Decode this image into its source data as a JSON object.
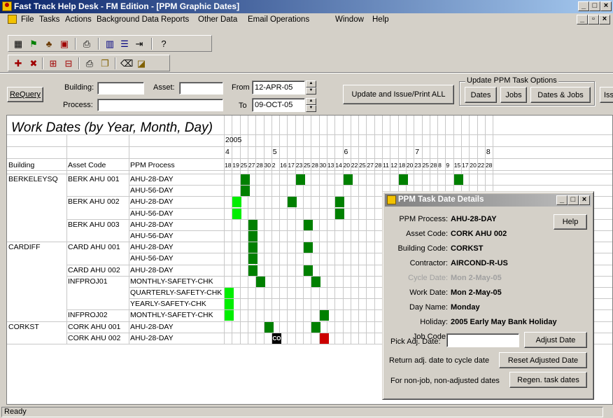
{
  "window": {
    "title": "Fast Track Help Desk - FM Edition - [PPM Graphic Dates]"
  },
  "menu": [
    "File",
    "Tasks",
    "Actions",
    "Background Data",
    "Reports",
    "Other Data",
    "Email Operations",
    "Window",
    "Help"
  ],
  "filters": {
    "requery_label": "ReQuery",
    "building_label": "Building:",
    "building_value": "",
    "asset_label": "Asset:",
    "asset_value": "",
    "process_label": "Process:",
    "process_value": "",
    "from_label": "From",
    "from_value": "12-APR-05",
    "to_label": "To",
    "to_value": "09-OCT-05",
    "update_all_label": "Update and Issue/Print ALL",
    "options_group_label": "Update PPM Task Options",
    "dates_label": "Dates",
    "jobs_label": "Jobs",
    "dates_jobs_label": "Dates & Jobs",
    "issue_label": "Iss"
  },
  "grid": {
    "title": "Work Dates (by Year, Month, Day)",
    "year": "2005",
    "months": [
      {
        "label": "4",
        "col": 0
      },
      {
        "label": "5",
        "col": 6
      },
      {
        "label": "6",
        "col": 15
      },
      {
        "label": "7",
        "col": 24
      },
      {
        "label": "8",
        "col": 33
      }
    ],
    "col_headers": {
      "building": "Building",
      "asset": "Asset Code",
      "process": "PPM Process"
    },
    "days": [
      "18",
      "19",
      "25",
      "27",
      "28",
      "30",
      "2",
      "16",
      "17",
      "23",
      "25",
      "28",
      "30",
      "13",
      "14",
      "20",
      "22",
      "25",
      "27",
      "28",
      "11",
      "12",
      "18",
      "20",
      "23",
      "25",
      "28",
      "8",
      "9",
      "15",
      "17",
      "20",
      "22",
      "28"
    ],
    "rows": [
      {
        "building": "BERKELEYSQ",
        "asset": "BERK AHU 001",
        "process": "AHU-28-DAY"
      },
      {
        "building": "",
        "asset": "",
        "process": "AHU-56-DAY"
      },
      {
        "building": "",
        "asset": "BERK AHU 002",
        "process": "AHU-28-DAY"
      },
      {
        "building": "",
        "asset": "",
        "process": "AHU-56-DAY"
      },
      {
        "building": "",
        "asset": "BERK AHU 003",
        "process": "AHU-28-DAY"
      },
      {
        "building": "",
        "asset": "",
        "process": "AHU-56-DAY"
      },
      {
        "building": "CARDIFF",
        "asset": "CARD AHU 001",
        "process": "AHU-28-DAY"
      },
      {
        "building": "",
        "asset": "",
        "process": "AHU-56-DAY"
      },
      {
        "building": "",
        "asset": "CARD AHU 002",
        "process": "AHU-28-DAY"
      },
      {
        "building": "",
        "asset": "INFPROJ01",
        "process": "MONTHLY-SAFETY-CHK"
      },
      {
        "building": "",
        "asset": "",
        "process": "QUARTERLY-SAFETY-CHK"
      },
      {
        "building": "",
        "asset": "",
        "process": "YEARLY-SAFETY-CHK"
      },
      {
        "building": "",
        "asset": "INFPROJ02",
        "process": "MONTHLY-SAFETY-CHK"
      },
      {
        "building": "CORKST",
        "asset": "CORK AHU 001",
        "process": "AHU-28-DAY"
      },
      {
        "building": "",
        "asset": "CORK AHU 002",
        "process": "AHU-28-DAY"
      }
    ],
    "marks": [
      {
        "row": 0,
        "col": 2,
        "kind": "green"
      },
      {
        "row": 0,
        "col": 9,
        "kind": "green"
      },
      {
        "row": 0,
        "col": 15,
        "kind": "green"
      },
      {
        "row": 0,
        "col": 22,
        "kind": "green"
      },
      {
        "row": 0,
        "col": 29,
        "kind": "green"
      },
      {
        "row": 1,
        "col": 2,
        "kind": "green"
      },
      {
        "row": 2,
        "col": 1,
        "kind": "lime"
      },
      {
        "row": 2,
        "col": 8,
        "kind": "green"
      },
      {
        "row": 2,
        "col": 14,
        "kind": "green"
      },
      {
        "row": 3,
        "col": 1,
        "kind": "lime"
      },
      {
        "row": 3,
        "col": 14,
        "kind": "green"
      },
      {
        "row": 4,
        "col": 3,
        "kind": "green"
      },
      {
        "row": 4,
        "col": 10,
        "kind": "green"
      },
      {
        "row": 5,
        "col": 3,
        "kind": "green"
      },
      {
        "row": 6,
        "col": 3,
        "kind": "green"
      },
      {
        "row": 6,
        "col": 10,
        "kind": "green"
      },
      {
        "row": 7,
        "col": 3,
        "kind": "green"
      },
      {
        "row": 8,
        "col": 3,
        "kind": "green"
      },
      {
        "row": 8,
        "col": 10,
        "kind": "green"
      },
      {
        "row": 9,
        "col": 4,
        "kind": "green"
      },
      {
        "row": 9,
        "col": 11,
        "kind": "green"
      },
      {
        "row": 9,
        "col": 33,
        "kind": "green"
      },
      {
        "row": 10,
        "col": 0,
        "kind": "lime"
      },
      {
        "row": 11,
        "col": 0,
        "kind": "lime"
      },
      {
        "row": 12,
        "col": 0,
        "kind": "lime"
      },
      {
        "row": 12,
        "col": 12,
        "kind": "green"
      },
      {
        "row": 13,
        "col": 5,
        "kind": "green"
      },
      {
        "row": 13,
        "col": 11,
        "kind": "green"
      },
      {
        "row": 14,
        "col": 6,
        "kind": "black"
      },
      {
        "row": 14,
        "col": 12,
        "kind": "red"
      }
    ],
    "mark_label": "CO"
  },
  "colors": {
    "green": "#008000",
    "lime": "#00ee00",
    "black": "#000000",
    "red": "#cc0000"
  },
  "dialog": {
    "title": "PPM Task Date Details",
    "help_label": "Help",
    "ppm_process_label": "PPM Process:",
    "ppm_process_value": "AHU-28-DAY",
    "asset_code_label": "Asset Code:",
    "asset_code_value": "CORK AHU 002",
    "building_code_label": "Building Code:",
    "building_code_value": "CORKST",
    "contractor_label": "Contractor:",
    "contractor_value": "AIRCOND-R-US",
    "cycle_date_label": "Cycle Date:",
    "cycle_date_value": "Mon 2-May-05",
    "work_date_label": "Work Date:",
    "work_date_value": "Mon 2-May-05",
    "day_name_label": "Day Name:",
    "day_name_value": "Monday",
    "holiday_label": "Holiday:",
    "holiday_value": "2005 Early May Bank Holiday",
    "job_code_label": "Job Code:",
    "job_code_value": "",
    "pick_adj_label": "Pick Adj. Date:",
    "pick_adj_value": "",
    "adjust_label": "Adjust Date",
    "return_text": "Return adj. date to cycle date",
    "reset_label": "Reset Adjusted Date",
    "nonjob_text": "For non-job, non-adjusted dates",
    "regen_label": "Regen. task dates"
  },
  "status": {
    "text": "Ready"
  }
}
